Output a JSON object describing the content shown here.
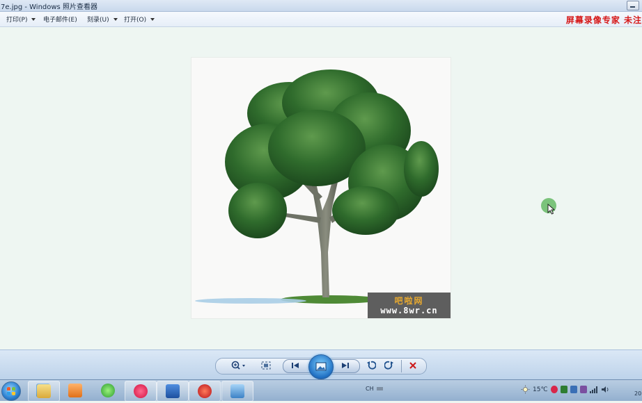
{
  "window": {
    "title": "7e.jpg - Windows 照片查看器"
  },
  "menu": {
    "items": [
      {
        "label": "打印(P)",
        "has_dropdown": true
      },
      {
        "label": "电子邮件(E)",
        "has_dropdown": false
      },
      {
        "label": "刻录(U)",
        "has_dropdown": true
      },
      {
        "label": "打开(O)",
        "has_dropdown": true
      }
    ],
    "overlay_watermark": "屏幕录像专家 未注"
  },
  "photo": {
    "logo_top": "吧啦网",
    "logo_bottom": "www.8wr.cn"
  },
  "controls": {
    "zoom": "zoom-icon",
    "actual_size": "actual-size-icon",
    "previous": "previous-icon",
    "slideshow": "slideshow-icon",
    "next": "next-icon",
    "rotate_ccw": "rotate-left-icon",
    "rotate_cw": "rotate-right-icon",
    "delete": "delete-icon"
  },
  "taskbar": {
    "language": "CH",
    "temperature": "15℃",
    "clock_partial": "20"
  },
  "colors": {
    "accent": "#1f6fc2",
    "watermark_red": "#d61818",
    "logo_orange": "#e6a830"
  }
}
